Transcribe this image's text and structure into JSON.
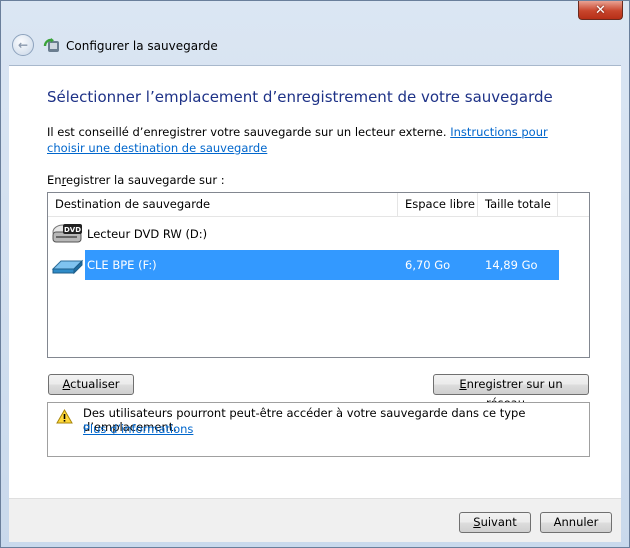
{
  "window": {
    "title": "Configurer la sauvegarde",
    "close_glyph": "✕"
  },
  "main": {
    "heading": "Sélectionner l’emplacement d’enregistrement de votre sauvegarde",
    "description": "Il est conseillé d’enregistrer votre sauvegarde sur un lecteur externe.",
    "instructions_link": "Instructions pour choisir une destination de sauvegarde",
    "save_label": "Enregistrer la sauvegarde sur :"
  },
  "destinations": {
    "columns": [
      "Destination de sauvegarde",
      "Espace libre",
      "Taille totale"
    ],
    "rows": [
      {
        "name": "Lecteur DVD RW (D:)",
        "free": "",
        "total": "",
        "icon": "dvd-drive-icon",
        "selected": false
      },
      {
        "name": "CLE BPE (F:)",
        "free": "6,70 Go",
        "total": "14,89 Go",
        "icon": "usb-drive-icon",
        "selected": true
      }
    ]
  },
  "buttons": {
    "refresh_pre": "",
    "refresh_u": "A",
    "refresh_post": "ctualiser",
    "network_pre": "",
    "network_u": "E",
    "network_post": "nregistrer sur un réseau...",
    "next_pre": "",
    "next_u": "S",
    "next_post": "uivant",
    "cancel": "Annuler"
  },
  "warning": {
    "text": "Des utilisateurs pourront peut-être accéder à votre sauvegarde dans ce type d’emplacement.",
    "link": "Plus d’informations"
  },
  "colors": {
    "heading": "#1e3287",
    "link": "#0066cc",
    "selection": "#3399ff",
    "frame": "#c9d9ec"
  }
}
